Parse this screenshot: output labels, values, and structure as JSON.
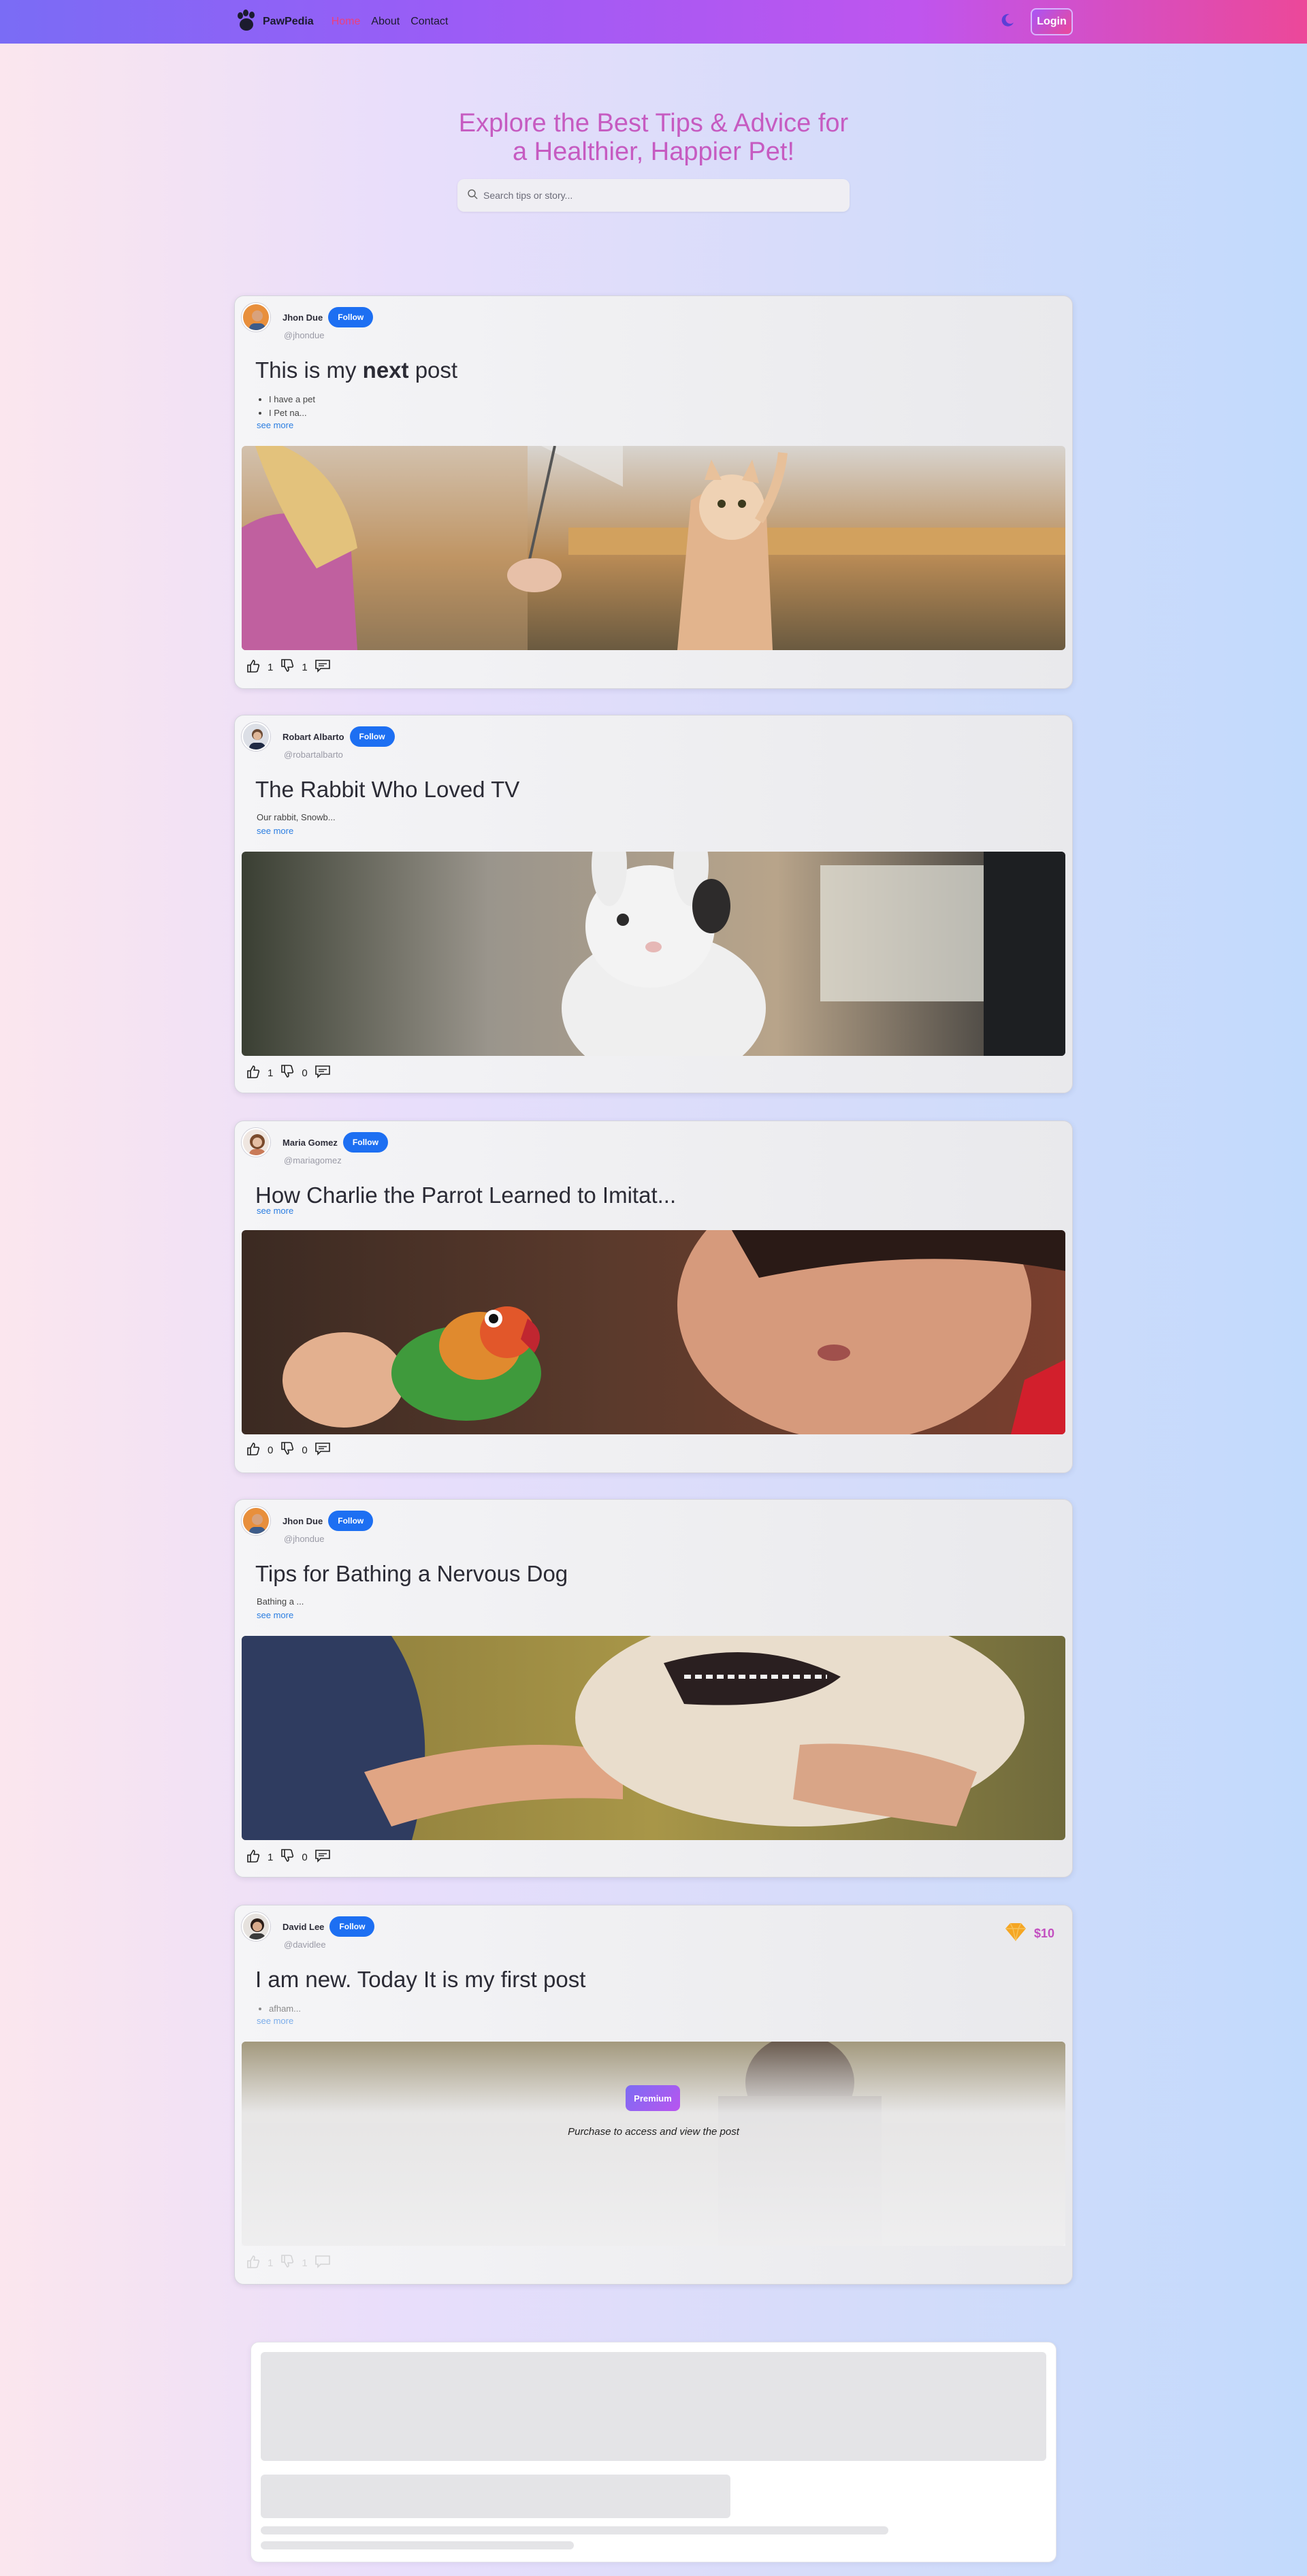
{
  "nav": {
    "brand": "PawPedia",
    "links": [
      "Home",
      "About",
      "Contact"
    ],
    "login_label": "Login",
    "icons": {
      "logo": "paw-icon",
      "theme": "moon-icon"
    }
  },
  "hero": {
    "title_line1": "Explore the Best Tips & Advice for",
    "title_line2": "a Healthier, Happier Pet!",
    "search_placeholder": "Search tips or story..."
  },
  "follow_label": "Follow",
  "see_more_label": "see more",
  "posts": [
    {
      "author": "Jhon Due",
      "handle": "@jhondue",
      "title_pre": "This is my ",
      "title_bold": "next",
      "title_post": " post",
      "bullets": [
        "I have a pet",
        "I Pet na..."
      ],
      "likes": "1",
      "dislikes": "1",
      "image": "girl-playing-with-cat"
    },
    {
      "author": "Robart Albarto",
      "handle": "@robartalbarto",
      "title": "The Rabbit Who Loved TV",
      "excerpt": "Our rabbit, Snowb...",
      "likes": "1",
      "dislikes": "0",
      "image": "white-rabbit-by-window"
    },
    {
      "author": "Maria Gomez",
      "handle": "@mariagomez",
      "title": "How Charlie the Parrot Learned to Imitat...",
      "likes": "0",
      "dislikes": "0",
      "image": "girl-with-lovebird"
    },
    {
      "author": "Jhon Due",
      "handle": "@jhondue",
      "title": "Tips for Bathing a Nervous Dog",
      "excerpt": "Bathing a ...",
      "likes": "1",
      "dislikes": "0",
      "image": "hand-holding-dog"
    },
    {
      "author": "David Lee",
      "handle": "@davidlee",
      "title": "I am new. Today It is my first post",
      "bullets": [
        "afham..."
      ],
      "likes": "1",
      "dislikes": "1",
      "premium": {
        "price": "$10",
        "badge": "Premium",
        "note": "Purchase to access and view the post",
        "icon": "diamond-icon"
      },
      "image": "locked-premium-image"
    }
  ],
  "colors": {
    "accent": "#1d6ff2",
    "brand_pink": "#c65bc1",
    "nav_start": "#7a6cf5",
    "nav_end": "#ec4899"
  }
}
